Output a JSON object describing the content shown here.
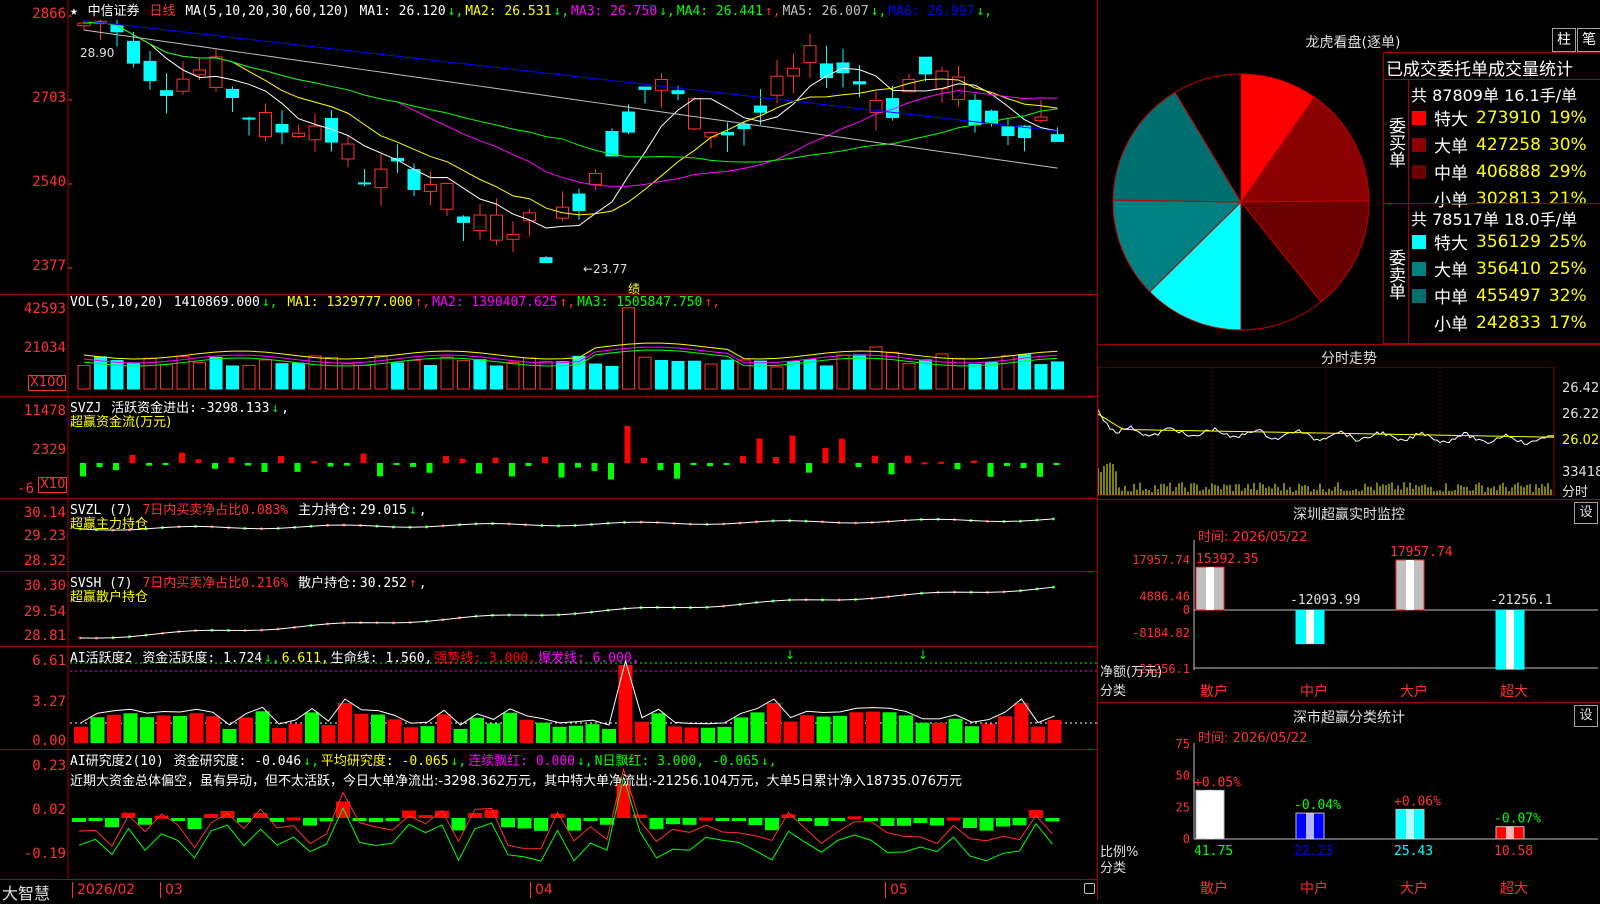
{
  "stock": {
    "mark": "★",
    "name": "中信证券",
    "period": "日线"
  },
  "ma_header": {
    "label": "MA(5,10,20,30,60,120)",
    "items": [
      {
        "name": "MA1:",
        "value": "26.120",
        "arrow": "↓",
        "color": "#ffffff"
      },
      {
        "name": "MA2:",
        "value": "26.531",
        "arrow": "↓",
        "color": "#ffff00"
      },
      {
        "name": "MA3:",
        "value": "26.750",
        "arrow": "↓",
        "color": "#ff00ff"
      },
      {
        "name": "MA4:",
        "value": "26.441",
        "arrow": "↑",
        "color": "#00ff00"
      },
      {
        "name": "MA5:",
        "value": "26.007",
        "arrow": "↓",
        "color": "#c0c0c0"
      },
      {
        "name": "MA6:",
        "value": "26.997",
        "arrow": "↓",
        "color": "#0000ff"
      }
    ]
  },
  "price_axis": [
    "2866",
    "2703",
    "2540",
    "2377"
  ],
  "annotations": {
    "high": "28.90",
    "low": "←23.77",
    "tag": "绩"
  },
  "vol_header": {
    "label": "VOL(5,10,20)",
    "value": "1410869.000",
    "items": [
      {
        "name": "MA1:",
        "value": "1329777.000",
        "arrow": "↑",
        "color": "#ffff00"
      },
      {
        "name": "MA2:",
        "value": "1390407.625",
        "arrow": "↑",
        "color": "#ff00ff"
      },
      {
        "name": "MA3:",
        "value": "1505847.750",
        "arrow": "↑",
        "color": "#00ff00"
      }
    ]
  },
  "vol_axis": [
    "42593",
    "21034"
  ],
  "vol_unit": "X100",
  "svzj": {
    "name": "SVZJ",
    "label": "活跃资金进出:",
    "value": "-3298.133",
    "arrow": "↓",
    "subtitle": "超赢资金流(万元)",
    "axis": [
      "11478",
      "2329",
      "-6"
    ],
    "unit": "X10"
  },
  "svzl": {
    "name": "SVZL (7)",
    "text": "7日内买卖净占比0.083%",
    "label": "主力持仓:",
    "value": "29.015",
    "arrow": "↓",
    "subtitle": "超赢主力持仓",
    "axis": [
      "30.14",
      "29.23",
      "28.32"
    ]
  },
  "svsh": {
    "name": "SVSH (7)",
    "text": "7日内买卖净占比0.216%",
    "label": "散户持仓:",
    "value": "30.252",
    "arrow": "↑",
    "subtitle": "超赢散户持仓",
    "axis": [
      "30.30",
      "29.54",
      "28.81"
    ]
  },
  "ai_active": {
    "name": "AI活跃度2",
    "items": [
      {
        "text": "资金活跃度: 1.724",
        "arrow": "↓",
        "color": "#ffffff"
      },
      {
        "text": "6.611,",
        "arrow": "",
        "color": "#ffff00"
      },
      {
        "text": "生命线: 1.560,",
        "arrow": "",
        "color": "#ffffff"
      },
      {
        "text": "强势线: 3.000,",
        "arrow": "",
        "color": "#ff0000"
      },
      {
        "text": "爆发线: 6.000,",
        "arrow": "",
        "color": "#ff00ff"
      }
    ],
    "axis": [
      "6.61",
      "3.27",
      "0.00"
    ]
  },
  "ai_research": {
    "name": "AI研究度2(10)",
    "items": [
      {
        "text": "资金研究度: -0.046",
        "arrow": "↓",
        "color": "#ffffff"
      },
      {
        "text": "平均研究度: -0.065",
        "arrow": "↓",
        "color": "#ffff00"
      },
      {
        "text": "连续飘红: 0.000",
        "arrow": "↓",
        "color": "#ff00ff"
      },
      {
        "text": "N日飘红: 3.000, -0.065",
        "arrow": "↓",
        "color": "#00ff00"
      }
    ],
    "comment": "近期大资金总体偏空，虽有异动，但不太活跃，今日大单净流出:-3298.362万元，其中特大单净流出:-21256.104万元，大单5日累计净入18735.076万元",
    "axis": [
      "0.23",
      "0.02",
      "-0.19"
    ]
  },
  "bottom_bar": {
    "brand": "大智慧",
    "dates": [
      "2026/02",
      "03",
      "04",
      "05"
    ]
  },
  "lhkp": {
    "title": "龙虎看盘(逐单)",
    "btn_bar": "柱",
    "btn_count": "笔",
    "stats_title": "已成交委托单成交量统计",
    "buy": {
      "side": "委买单",
      "total": "共 87809单 16.1手/单",
      "rows": [
        {
          "name": "特大",
          "value": "273910",
          "pct": "19%",
          "color": "#ff0000"
        },
        {
          "name": "大单",
          "value": "427258",
          "pct": "30%",
          "color": "#8b0000"
        },
        {
          "name": "中单",
          "value": "406888",
          "pct": "29%",
          "color": "#6b0000"
        },
        {
          "name": "小单",
          "value": "302813",
          "pct": "21%",
          "color": "#000000"
        }
      ]
    },
    "sell": {
      "side": "委卖单",
      "total": "共 78517单 18.0手/单",
      "rows": [
        {
          "name": "特大",
          "value": "356129",
          "pct": "25%",
          "color": "#00ffff"
        },
        {
          "name": "大单",
          "value": "356410",
          "pct": "25%",
          "color": "#008080"
        },
        {
          "name": "中单",
          "value": "455497",
          "pct": "32%",
          "color": "#006f6f"
        },
        {
          "name": "小单",
          "value": "242833",
          "pct": "17%",
          "color": "#000000"
        }
      ]
    }
  },
  "intraday": {
    "title": "分时走势",
    "axis": [
      "26.42",
      "26.22",
      "26.02",
      "33418"
    ],
    "unit": "分时"
  },
  "monitor": {
    "title": "深圳超赢实时监控",
    "btn": "设",
    "time": "时间: 2026/05/22",
    "axis": [
      "17957.74",
      "4886.46",
      "0",
      "-8184.82",
      "-21256.1"
    ],
    "ylabel": "净额(万元)",
    "xlabel": "分类",
    "bars": [
      {
        "name": "散户",
        "value": 15392.35,
        "label": "15392.35"
      },
      {
        "name": "中户",
        "value": -12093.99,
        "label": "-12093.99"
      },
      {
        "name": "大户",
        "value": 17957.74,
        "label": "17957.74"
      },
      {
        "name": "超大",
        "value": -21256.1,
        "label": "-21256.1"
      }
    ]
  },
  "classify": {
    "title": "深市超赢分类统计",
    "btn": "设",
    "time": "时间: 2026/05/22",
    "axis": [
      "75",
      "50",
      "25",
      "0"
    ],
    "ylabel": "比例%",
    "xlabel": "分类",
    "bars": [
      {
        "name": "散户",
        "value": 41.75,
        "label": "41.75",
        "change": "+0.05%",
        "color": "#ffffff"
      },
      {
        "name": "中户",
        "value": 22.23,
        "label": "22.23",
        "change": "-0.04%",
        "color": "#0000ff"
      },
      {
        "name": "大户",
        "value": 25.43,
        "label": "25.43",
        "change": "+0.06%",
        "color": "#00ffff"
      },
      {
        "name": "超大",
        "value": 10.58,
        "label": "10.58",
        "change": "-0.07%",
        "color": "#ff0000"
      }
    ]
  }
}
